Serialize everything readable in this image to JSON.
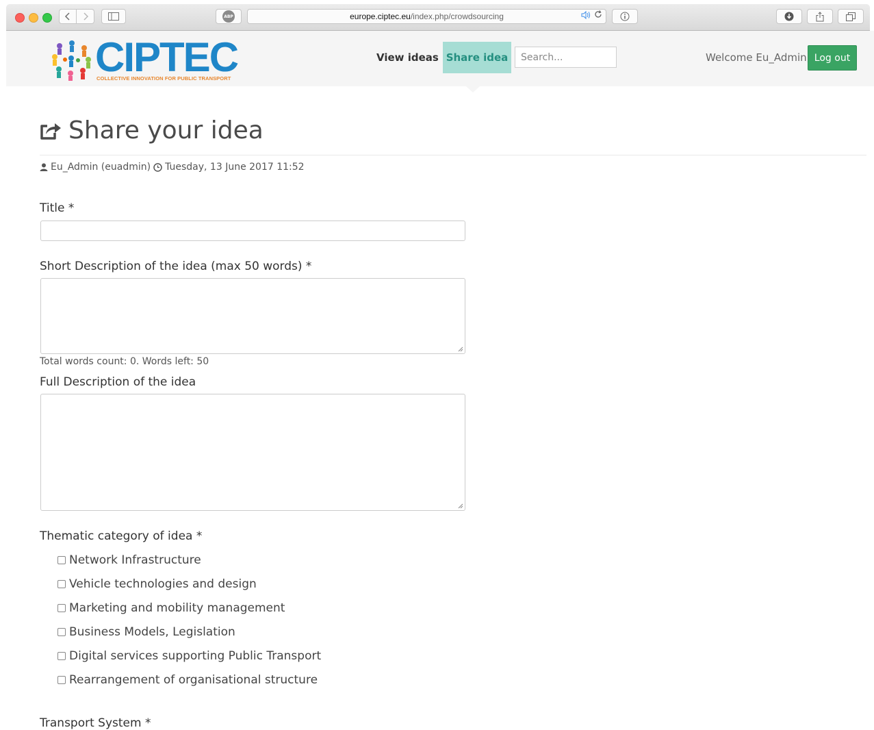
{
  "browser": {
    "url_domain": "europe.ciptec.eu",
    "url_path": "/index.php/crowdsourcing",
    "abp_label": "ABP"
  },
  "header": {
    "logo_text": "CIPTEC",
    "logo_tagline": "COLLECTIVE INNOVATION FOR PUBLIC TRANSPORT",
    "nav": {
      "view_ideas": "View ideas",
      "share_idea": "Share idea"
    },
    "search_placeholder": "Search...",
    "welcome": "Welcome Eu_Admin,",
    "logout": "Log out"
  },
  "page": {
    "title": "Share your idea",
    "author": "Eu_Admin (euadmin)",
    "datetime": "Tuesday, 13 June 2017 11:52"
  },
  "form": {
    "title_label": "Title *",
    "title_value": "",
    "short_desc_label": "Short Description of the idea (max 50 words) *",
    "short_desc_value": "",
    "word_count_text": "Total words count: 0. Words left: 50",
    "full_desc_label": "Full Description of the idea",
    "full_desc_value": "",
    "category_label": "Thematic category of idea *",
    "categories": [
      {
        "label": "Network Infrastructure",
        "checked": false
      },
      {
        "label": "Vehicle technologies and design",
        "checked": false
      },
      {
        "label": "Marketing and mobility management",
        "checked": false
      },
      {
        "label": "Business Models, Legislation",
        "checked": false
      },
      {
        "label": "Digital services supporting Public Transport",
        "checked": false
      },
      {
        "label": "Rearrangement of organisational structure",
        "checked": false
      }
    ],
    "transport_label": "Transport System *"
  },
  "colors": {
    "brand_blue": "#1f86c8",
    "share_tab_bg": "#a6ddd4",
    "share_tab_text": "#248f80",
    "logout_green": "#3aa463"
  }
}
